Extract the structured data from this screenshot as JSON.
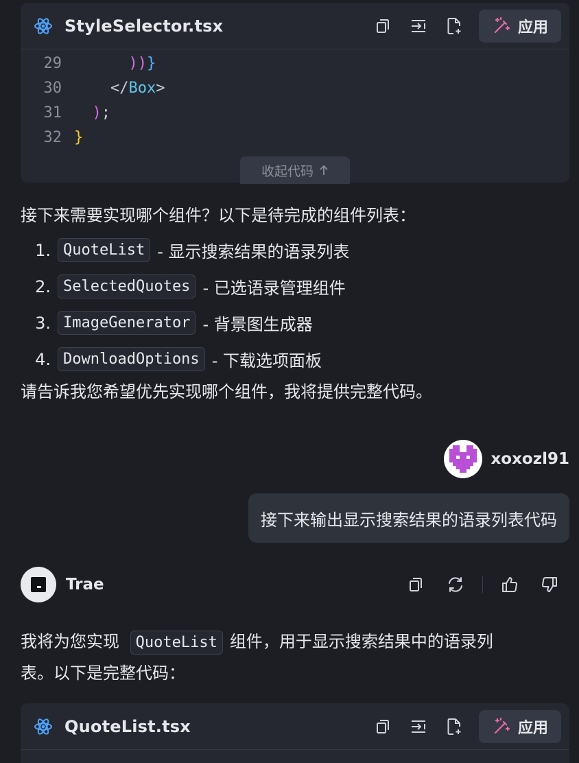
{
  "top_card": {
    "file_name": "StyleSelector.tsx",
    "apply_label": "应用",
    "collapse_label": "收起代码",
    "lines": [
      {
        "num": "29",
        "tokens": [
          {
            "t": "      ",
            "c": "tok-gray"
          },
          {
            "t": "))",
            "c": "tok-pink"
          },
          {
            "t": "}",
            "c": "tok-blue"
          }
        ]
      },
      {
        "num": "30",
        "tokens": [
          {
            "t": "    </",
            "c": "tok-gray"
          },
          {
            "t": "Box",
            "c": "tok-cyan"
          },
          {
            "t": ">",
            "c": "tok-gray"
          }
        ]
      },
      {
        "num": "31",
        "tokens": [
          {
            "t": "  ",
            "c": "tok-gray"
          },
          {
            "t": ")",
            "c": "tok-pink"
          },
          {
            "t": ";",
            "c": "tok-gray"
          }
        ]
      },
      {
        "num": "32",
        "tokens": [
          {
            "t": "}",
            "c": "tok-yellow"
          }
        ]
      }
    ]
  },
  "message1": {
    "intro": "接下来需要实现哪个组件？以下是待完成的组件列表：",
    "items": [
      {
        "num": "1.",
        "code": "QuoteList",
        "desc": "- 显示搜索结果的语录列表"
      },
      {
        "num": "2.",
        "code": "SelectedQuotes",
        "desc": "- 已选语录管理组件"
      },
      {
        "num": "3.",
        "code": "ImageGenerator",
        "desc": "- 背景图生成器"
      },
      {
        "num": "4.",
        "code": "DownloadOptions",
        "desc": "- 下载选项面板"
      }
    ],
    "outro": "请告诉我您希望优先实现哪个组件，我将提供完整代码。"
  },
  "user": {
    "name": "xoxozl91",
    "message": "接下来输出显示搜索结果的语录列表代码"
  },
  "assistant": {
    "name": "Trae",
    "reply_pre": "我将为您实现",
    "reply_code": "QuoteList",
    "reply_post": "组件，用于显示搜索结果中的语录列",
    "reply_line2": "表。以下是完整代码："
  },
  "bottom_card": {
    "file_name": "QuoteList.tsx",
    "apply_label": "应用"
  },
  "colors": {
    "background": "#1c1e24",
    "card": "#252830",
    "accent_pink": "#d36ee3",
    "react_blue": "#4fa3ff",
    "avatar_purple": "#b84fd6"
  }
}
